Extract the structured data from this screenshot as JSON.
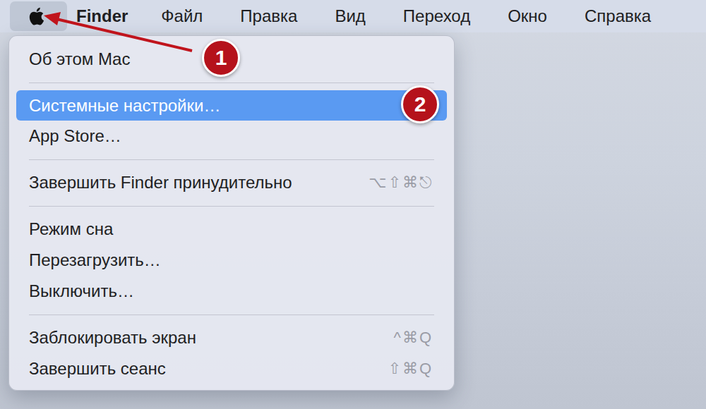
{
  "menubar": {
    "apple_menu": {
      "selected": true
    },
    "items": [
      {
        "label": "Finder",
        "kind": "app"
      },
      {
        "label": "Файл",
        "kind": "menu"
      },
      {
        "label": "Правка",
        "kind": "menu"
      },
      {
        "label": "Вид",
        "kind": "menu"
      },
      {
        "label": "Переход",
        "kind": "menu"
      },
      {
        "label": "Окно",
        "kind": "menu"
      },
      {
        "label": "Справка",
        "kind": "menu"
      }
    ]
  },
  "menu": {
    "items": [
      {
        "kind": "item",
        "label": "Об этом Mac",
        "selected": false
      },
      {
        "kind": "separator"
      },
      {
        "kind": "item",
        "label": "Системные настройки…",
        "selected": true
      },
      {
        "kind": "item",
        "label": "App Store…",
        "selected": false
      },
      {
        "kind": "separator"
      },
      {
        "kind": "item",
        "label": "Завершить Finder принудительно",
        "selected": false,
        "shortcut": "⌥⇧⌘⎋"
      },
      {
        "kind": "separator"
      },
      {
        "kind": "item",
        "label": "Режим сна",
        "selected": false
      },
      {
        "kind": "item",
        "label": "Перезагрузить…",
        "selected": false
      },
      {
        "kind": "item",
        "label": "Выключить…",
        "selected": false
      },
      {
        "kind": "separator"
      },
      {
        "kind": "item",
        "label": "Заблокировать экран",
        "selected": false,
        "shortcut": "^⌘Q"
      },
      {
        "kind": "item",
        "label": "Завершить сеанс",
        "selected": false,
        "shortcut": "⇧⌘Q"
      }
    ]
  },
  "annotations": [
    {
      "label": "1"
    },
    {
      "label": "2"
    }
  ]
}
